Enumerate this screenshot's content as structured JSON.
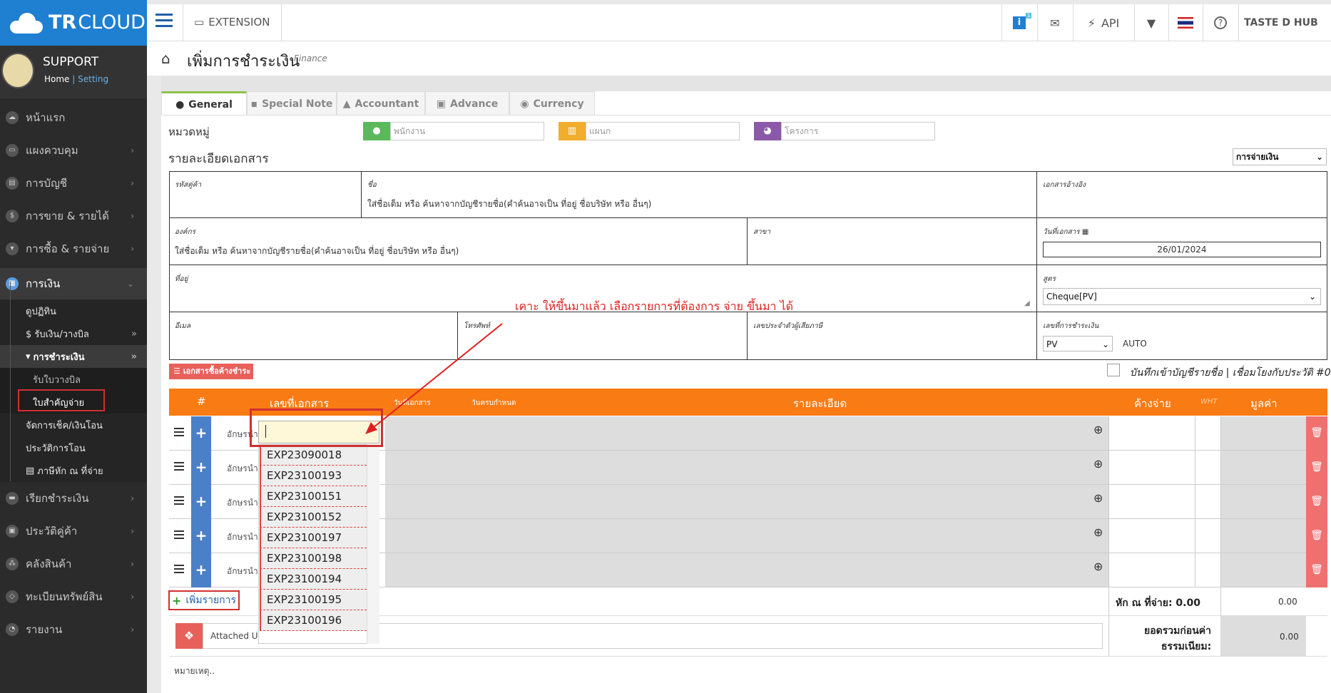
{
  "brand": {
    "name_bold": "TR",
    "name_light": "CLOUD"
  },
  "profile": {
    "name": "SUPPORT",
    "home": "Home",
    "sep": "|",
    "setting": "Setting"
  },
  "sidebar": {
    "items": [
      {
        "label": "หน้าแรก",
        "icon": "home-icon"
      },
      {
        "label": "แผงควบคุม",
        "icon": "monitor-icon"
      },
      {
        "label": "การบัญชี",
        "icon": "book-icon"
      },
      {
        "label": "การขาย & รายได้",
        "icon": "dollar-icon"
      },
      {
        "label": "การซื้อ & รายจ่าย",
        "icon": "cart-icon"
      },
      {
        "label": "การเงิน",
        "icon": "calendar-icon"
      }
    ],
    "finance_subs": [
      {
        "label": "ดูปฏิทิน"
      },
      {
        "label": "$ รับเงิน/วางบิล"
      },
      {
        "label": "การชำระเงิน"
      }
    ],
    "payment_subs": [
      {
        "label": "รับใบวางบิล"
      },
      {
        "label": "ใบสำคัญจ่าย"
      }
    ],
    "finance_more": [
      {
        "label": "จัดการเช็ค/เงินโอน"
      },
      {
        "label": "ประวัติการโอน"
      },
      {
        "label": "ภาษีหัก ณ ที่จ่าย"
      }
    ],
    "items2": [
      {
        "label": "เรียกชำระเงิน",
        "icon": "card-icon"
      },
      {
        "label": "ประวัติคู่ค้า",
        "icon": "contact-icon"
      },
      {
        "label": "คลังสินค้า",
        "icon": "boxes-icon"
      },
      {
        "label": "ทะเบียนทรัพย์สิน",
        "icon": "diamond-icon"
      },
      {
        "label": "รายงาน",
        "icon": "chart-icon"
      }
    ]
  },
  "topbar": {
    "extension": "EXTENSION",
    "api": "API",
    "badge": "1",
    "company": "TASTE D HUB"
  },
  "page": {
    "title": "เพิ่มการชำระเงิน",
    "subtitle": "Finance"
  },
  "tabs": [
    "General",
    "Special Note",
    "Accountant",
    "Advance",
    "Currency"
  ],
  "category": {
    "label": "หมวดหมู่",
    "employee_ph": "พนักงาน",
    "dept_ph": "แผนก",
    "project_ph": "โครงการ"
  },
  "doc": {
    "section_title": "รายละเอียดเอกสาร",
    "type_select": "การจ่ายเงิน",
    "vendor_code_label": "รหัสคู่ค้า",
    "name_label": "ชื่อ",
    "name_ph": "ใส่ชื่อเต็ม หรือ ค้นหาจากบัญชีรายชื่อ(คำค้นอาจเป็น ที่อยู่ ชื่อบริษัท หรือ อื่นๆ)",
    "ref_label": "เอกสารอ้างอิง",
    "org_label": "องค์กร",
    "org_ph": "ใส่ชื่อเต็ม หรือ ค้นหาจากบัญชีรายชื่อ(คำค้นอาจเป็น ที่อยู่ ชื่อบริษัท หรือ อื่นๆ)",
    "branch_label": "สาขา",
    "date_label": "วันที่เอกสาร",
    "date_value": "26/01/2024",
    "address_label": "ที่อยู่",
    "formula_label": "สูตร",
    "formula_value": "Cheque[PV]",
    "email_label": "อีเมล",
    "phone_label": "โทรศัพท์",
    "taxid_label": "เลขประจำตัวผู้เสียภาษี",
    "payno_label": "เลขที่การชำระเงิน",
    "payno_prefix": "PV",
    "payno_auto": "AUTO"
  },
  "annotation": "เคาะ ให้ขึ้นมาแล้ว เลือกรายการที่ต้องการ จ่าย ขึ้นมา ได้",
  "pending_btn": "เอกสารซื้อค้างชำระ",
  "save_contact": "บันทึกเข้าบัญชีรายชื่อ | เชื่อมโยงกับประวัติ #0",
  "table": {
    "headers": {
      "num": "#",
      "docno": "เลขที่เอกสาร",
      "docdate": "วันที่เอกสาร",
      "duedate": "วันครบกำหนด",
      "detail": "รายละเอียด",
      "outstanding": "ค้างจ่าย",
      "wht": "WHT",
      "value": "มูลค่า"
    },
    "row_prefix": "อักษรนำ",
    "add_row": "เพิ่มรายการ",
    "wht_total": "หัก ณ ที่จ่าย: 0.00",
    "wht_value": "0.00",
    "subtotal_label1": "ยอดรวมก่อนค่า",
    "subtotal_label2": "ธรรมเนียม:",
    "subtotal_value": "0.00"
  },
  "attached": "Attached U",
  "remark": "หมายเหตุ..",
  "dropdown": [
    "EXP23090018",
    "EXP23100193",
    "EXP23100151",
    "EXP23100152",
    "EXP23100197",
    "EXP23100198",
    "EXP23100194",
    "EXP23100195",
    "EXP23100196"
  ]
}
